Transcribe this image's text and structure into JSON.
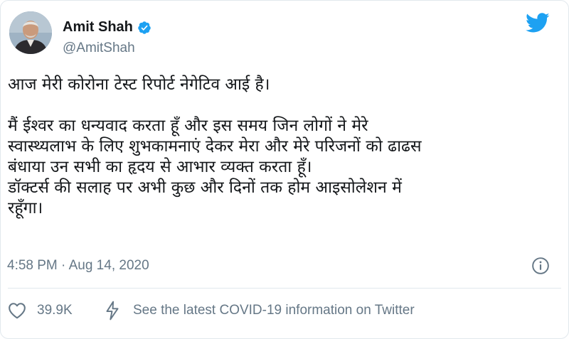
{
  "author": {
    "name": "Amit Shah",
    "handle": "@AmitShah",
    "verified": true
  },
  "tweet": {
    "line1": "आज मेरी कोरोना टेस्ट रिपोर्ट नेगेटिव आई है।",
    "para2_line1": "मैं ईश्वर का धन्यवाद करता हूँ और इस समय जिन लोगों ने मेरे",
    "para2_line2": "स्वास्थ्यलाभ के लिए शुभकामनाएं देकर मेरा और मेरे परिजनों को ढाढस",
    "para2_line3": "बंधाया उन सभी का हृदय से आभार व्यक्त करता हूँ।",
    "para2_line4": "डॉक्टर्स की सलाह पर अभी कुछ और दिनों तक होम आइसोलेशन में",
    "para2_line5": "रहूँगा।"
  },
  "meta": {
    "timestamp": "4:58 PM · Aug 14, 2020"
  },
  "actions": {
    "likes": "39.9K",
    "covid_link": "See the latest COVID-19 information on Twitter"
  },
  "colors": {
    "twitter_blue": "#1da1f2",
    "secondary_text": "#657786",
    "primary_text": "#14171a"
  },
  "icons": [
    "avatar-photo",
    "verified-badge-icon",
    "twitter-bird-icon",
    "info-icon",
    "heart-icon",
    "lightning-bolt-icon"
  ]
}
